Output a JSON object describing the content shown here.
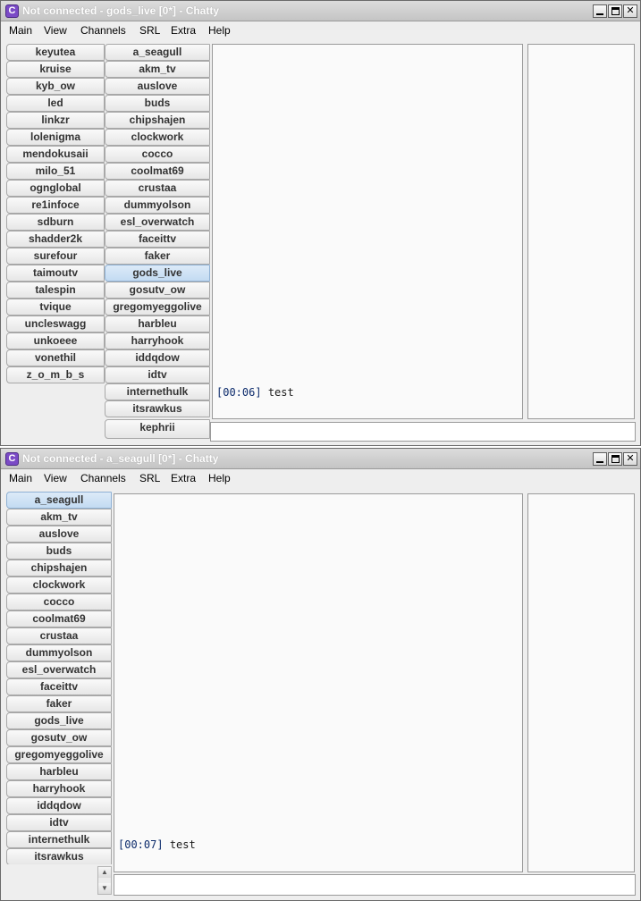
{
  "window_top": {
    "title": "Not connected - gods_live [0*] - Chatty",
    "icon_letter": "C",
    "menu": [
      "Main",
      "View",
      "Channels",
      "SRL",
      "Extra",
      "Help"
    ],
    "tabs_col1": [
      "keyutea",
      "kruise",
      "kyb_ow",
      "led",
      "linkzr",
      "lolenigma",
      "mendokusaii",
      "milo_51",
      "ognglobal",
      "re1infoce",
      "sdburn",
      "shadder2k",
      "surefour",
      "taimoutv",
      "talespin",
      "tvique",
      "uncleswagg",
      "unkoeee",
      "vonethil",
      "z_o_m_b_s"
    ],
    "tabs_col2": [
      "a_seagull",
      "akm_tv",
      "auslove",
      "buds",
      "chipshajen",
      "clockwork",
      "cocco",
      "coolmat69",
      "crustaa",
      "dummyolson",
      "esl_overwatch",
      "faceittv",
      "faker",
      "gods_live",
      "gosutv_ow",
      "gregomyeggolive",
      "harbleu",
      "harryhook",
      "iddqdow",
      "idtv",
      "internethulk",
      "itsrawkus",
      "kephrii"
    ],
    "selected_tab": "gods_live",
    "message": {
      "time": "[00:06]",
      "text": "test"
    },
    "input_value": ""
  },
  "window_bottom": {
    "title": "Not connected - a_seagull [0*] - Chatty",
    "icon_letter": "C",
    "menu": [
      "Main",
      "View",
      "Channels",
      "SRL",
      "Extra",
      "Help"
    ],
    "tabs": [
      "a_seagull",
      "akm_tv",
      "auslove",
      "buds",
      "chipshajen",
      "clockwork",
      "cocco",
      "coolmat69",
      "crustaa",
      "dummyolson",
      "esl_overwatch",
      "faceittv",
      "faker",
      "gods_live",
      "gosutv_ow",
      "gregomyeggolive",
      "harbleu",
      "harryhook",
      "iddqdow",
      "idtv",
      "internethulk",
      "itsrawkus"
    ],
    "selected_tab": "a_seagull",
    "message": {
      "time": "[00:07]",
      "text": "test"
    },
    "input_value": ""
  },
  "icons": {
    "app": "chatty-app-icon",
    "minimize": "minimize-icon",
    "maximize": "maximize-icon",
    "close": "close-icon",
    "scroll_up": "scroll-up-arrow-icon",
    "scroll_down": "scroll-down-arrow-icon"
  },
  "colors": {
    "selected_tab": "#c3dbf2",
    "timestamp": "#0b2a6b",
    "app_icon": "#7b4bc6"
  }
}
